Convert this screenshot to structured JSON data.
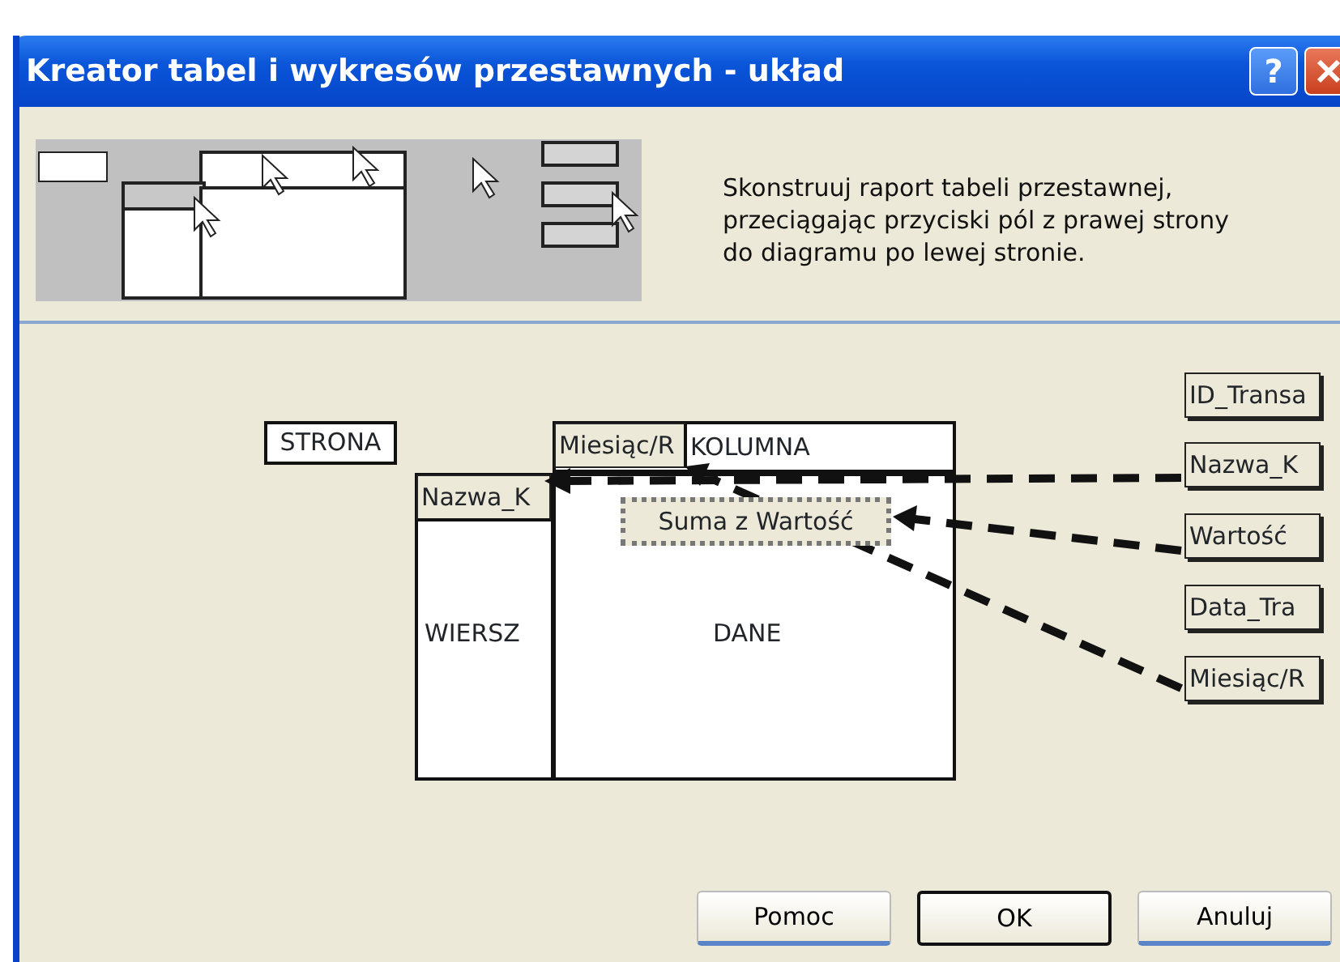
{
  "window": {
    "title": "Kreator tabel i wykresów przestawnych - układ",
    "title_buttons": [
      {
        "kind": "help",
        "label": "?"
      },
      {
        "kind": "close"
      }
    ]
  },
  "instructions": "Skonstruuj raport tabeli przestawnej, przeciągając przyciski pól z prawej strony do diagramu po lewej stronie.",
  "areas": [
    {
      "kind": "page",
      "label": "STRONA"
    },
    {
      "kind": "column",
      "label": "KOLUMNA",
      "fields": [
        "Miesiąc/R"
      ]
    },
    {
      "kind": "row",
      "label": "WIERSZ",
      "fields": [
        "Nazwa_K"
      ]
    },
    {
      "kind": "data",
      "label": "DANE",
      "fields": [
        "Suma z Wartość"
      ]
    }
  ],
  "field_list": [
    "ID_Transa",
    "Nazwa_K",
    "Wartość",
    "Data_Tra",
    "Miesiąc/R"
  ],
  "buttons": [
    {
      "label": "Pomoc",
      "default": false
    },
    {
      "label": "OK",
      "default": true
    },
    {
      "label": "Anuluj",
      "default": false
    }
  ]
}
